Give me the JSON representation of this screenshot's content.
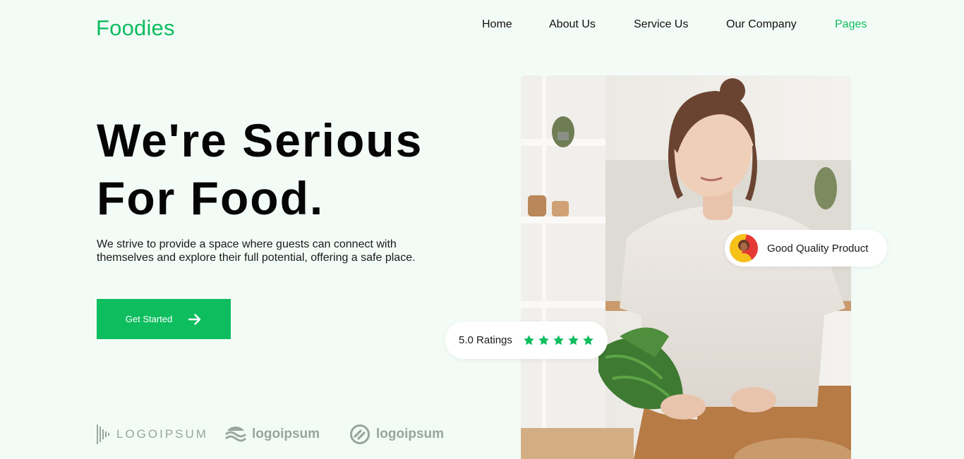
{
  "brand": {
    "name": "Foodies",
    "color": "#0dbd5e"
  },
  "nav": [
    {
      "label": "Home",
      "active": false
    },
    {
      "label": "About Us",
      "active": false
    },
    {
      "label": "Service Us",
      "active": false
    },
    {
      "label": "Our Company",
      "active": false
    },
    {
      "label": "Pages",
      "active": true
    }
  ],
  "hero": {
    "title_line1": "We're Serious",
    "title_line2": "For Food.",
    "description": "We strive to provide a space where guests can connect with themselves and explore their full potential, offering a safe place.",
    "cta_label": "Get Started",
    "cta_icon": "arrow-right-icon"
  },
  "badges": {
    "quality": {
      "label": "Good Quality Product",
      "icon": "avatar"
    },
    "rating": {
      "label": "5.0 Ratings",
      "stars": 5,
      "star_color": "#0dbd5e"
    }
  },
  "partners": [
    {
      "name": "LOGOIPSUM",
      "icon": "soundwave-logo-icon"
    },
    {
      "name": "logoipsum",
      "icon": "waves-logo-icon"
    },
    {
      "name": "logoipsum",
      "icon": "circle-logo-icon"
    }
  ],
  "colors": {
    "background": "#f3fbf6",
    "accent": "#0dbd5e",
    "partner_gray": "#9aa5a0"
  }
}
